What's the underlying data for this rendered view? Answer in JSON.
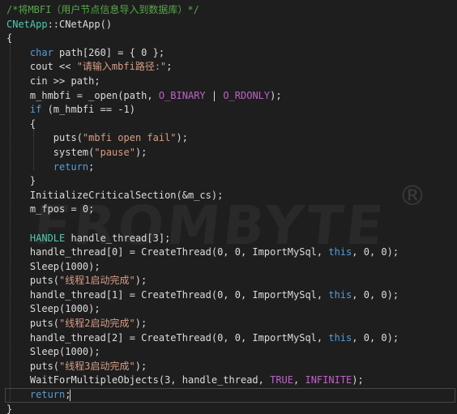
{
  "lines": [
    [
      {
        "t": "comment",
        "v": "/*将MBFI（用户节点信息导入到数据库）*/"
      }
    ],
    [
      {
        "t": "type",
        "v": "CNetApp"
      },
      {
        "t": "plain",
        "v": "::CNetApp()"
      }
    ],
    [
      {
        "t": "plain",
        "v": "{"
      }
    ],
    [
      {
        "t": "plain",
        "v": "    "
      },
      {
        "t": "kw",
        "v": "char"
      },
      {
        "t": "plain",
        "v": " path[260] = { 0 };"
      }
    ],
    [
      {
        "t": "plain",
        "v": "    cout << "
      },
      {
        "t": "str",
        "v": "\"请输入mbfi路径:\""
      },
      {
        "t": "plain",
        "v": ";"
      }
    ],
    [
      {
        "t": "plain",
        "v": "    cin >> path;"
      }
    ],
    [
      {
        "t": "plain",
        "v": "    m_hmbfi = _open(path, "
      },
      {
        "t": "macro",
        "v": "O_BINARY"
      },
      {
        "t": "plain",
        "v": " | "
      },
      {
        "t": "macro",
        "v": "O_RDONLY"
      },
      {
        "t": "plain",
        "v": ");"
      }
    ],
    [
      {
        "t": "plain",
        "v": "    "
      },
      {
        "t": "kw",
        "v": "if"
      },
      {
        "t": "plain",
        "v": " (m_hmbfi == -1)"
      }
    ],
    [
      {
        "t": "plain",
        "v": "    {"
      }
    ],
    [
      {
        "t": "plain",
        "v": "        puts("
      },
      {
        "t": "str",
        "v": "\"mbfi open fail\""
      },
      {
        "t": "plain",
        "v": ");"
      }
    ],
    [
      {
        "t": "plain",
        "v": "        system("
      },
      {
        "t": "str",
        "v": "\"pause\""
      },
      {
        "t": "plain",
        "v": ");"
      }
    ],
    [
      {
        "t": "plain",
        "v": "        "
      },
      {
        "t": "kw",
        "v": "return"
      },
      {
        "t": "plain",
        "v": ";"
      }
    ],
    [
      {
        "t": "plain",
        "v": "    }"
      }
    ],
    [
      {
        "t": "plain",
        "v": "    InitializeCriticalSection(&m_cs);"
      }
    ],
    [
      {
        "t": "plain",
        "v": "    m_fpos = 0;"
      }
    ],
    [
      {
        "t": "plain",
        "v": ""
      }
    ],
    [
      {
        "t": "plain",
        "v": "    "
      },
      {
        "t": "type",
        "v": "HANDLE"
      },
      {
        "t": "plain",
        "v": " handle_thread[3];"
      }
    ],
    [
      {
        "t": "plain",
        "v": "    handle_thread[0] = CreateThread(0, 0, ImportMySql, "
      },
      {
        "t": "kw",
        "v": "this"
      },
      {
        "t": "plain",
        "v": ", 0, 0);"
      }
    ],
    [
      {
        "t": "plain",
        "v": "    Sleep(1000);"
      }
    ],
    [
      {
        "t": "plain",
        "v": "    puts("
      },
      {
        "t": "str",
        "v": "\"线程1启动完成\""
      },
      {
        "t": "plain",
        "v": ");"
      }
    ],
    [
      {
        "t": "plain",
        "v": "    handle_thread[1] = CreateThread(0, 0, ImportMySql, "
      },
      {
        "t": "kw",
        "v": "this"
      },
      {
        "t": "plain",
        "v": ", 0, 0);"
      }
    ],
    [
      {
        "t": "plain",
        "v": "    Sleep(1000);"
      }
    ],
    [
      {
        "t": "plain",
        "v": "    puts("
      },
      {
        "t": "str",
        "v": "\"线程2启动完成\""
      },
      {
        "t": "plain",
        "v": ");"
      }
    ],
    [
      {
        "t": "plain",
        "v": "    handle_thread[2] = CreateThread(0, 0, ImportMySql, "
      },
      {
        "t": "kw",
        "v": "this"
      },
      {
        "t": "plain",
        "v": ", 0, 0);"
      }
    ],
    [
      {
        "t": "plain",
        "v": "    Sleep(1000);"
      }
    ],
    [
      {
        "t": "plain",
        "v": "    puts("
      },
      {
        "t": "str",
        "v": "\"线程3启动完成\""
      },
      {
        "t": "plain",
        "v": ");"
      }
    ],
    [
      {
        "t": "plain",
        "v": "    WaitForMultipleObjects(3, handle_thread, "
      },
      {
        "t": "macro",
        "v": "TRUE"
      },
      {
        "t": "plain",
        "v": ", "
      },
      {
        "t": "macro",
        "v": "INFINITE"
      },
      {
        "t": "plain",
        "v": ");"
      }
    ],
    [
      {
        "t": "plain",
        "v": "    "
      },
      {
        "t": "kw",
        "v": "return"
      },
      {
        "t": "plain",
        "v": ";"
      }
    ],
    [
      {
        "t": "plain",
        "v": "}"
      }
    ]
  ],
  "watermark": "FROMBYTE",
  "registered_mark": "®",
  "colors": {
    "background": "#1e1e1e",
    "comment": "#57a64a",
    "keyword": "#569cd6",
    "string": "#d69d85",
    "macro": "#bd63c5",
    "type": "#4ec9b0",
    "text": "#dcdcdc"
  }
}
